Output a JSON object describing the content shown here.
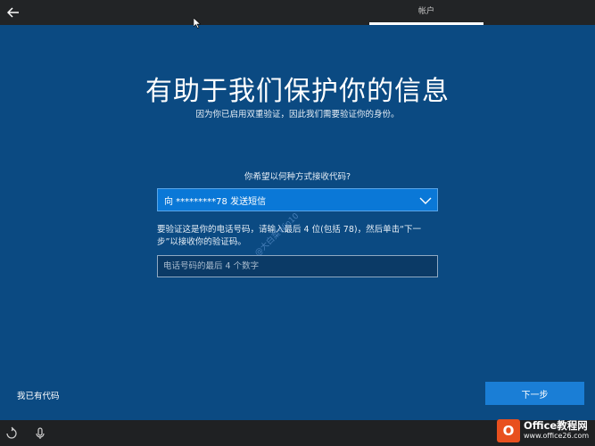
{
  "header": {
    "tab_label": "帐户"
  },
  "main": {
    "title": "有助于我们保护你的信息",
    "subtitle": "因为你已启用双重验证，因此我们需要验证你的身份。",
    "method_prompt": "你希望以何种方式接收代码?",
    "method_selected": "向 *********78 发送短信",
    "instruction": "要验证这是你的电话号码，请输入最后 4 位(包括 78)，然后单击“下一步”以接收你的验证码。",
    "code_placeholder": "电话号码的最后 4 个数字",
    "watermark": "@大白菜Win10"
  },
  "footer": {
    "have_code_label": "我已有代码",
    "next_label": "下一步"
  },
  "logo": {
    "main": "Office教程网",
    "sub": "www.office26.com"
  },
  "colors": {
    "background": "#0b4a82",
    "accent": "#1a7ed6",
    "select_bg": "#0a78d7",
    "topbar": "#222426"
  },
  "icons": {
    "back": "arrow-left-icon",
    "chevron": "chevron-down-icon",
    "ease_of_access": "ease-of-access-icon",
    "microphone": "microphone-icon"
  }
}
